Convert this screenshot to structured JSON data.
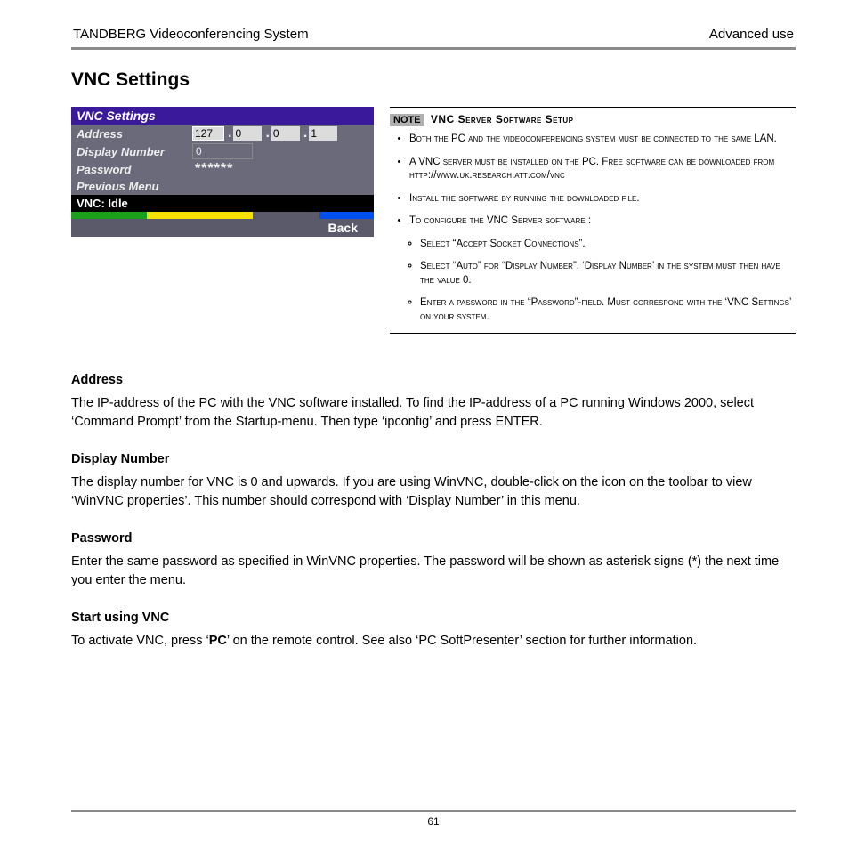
{
  "header": {
    "left": "TANDBERG Videoconferencing System",
    "right": "Advanced use"
  },
  "title": "VNC Settings",
  "panel": {
    "title": "VNC Settings",
    "rows": {
      "address_label": "Address",
      "ip": [
        "127",
        "0",
        "0",
        "1"
      ],
      "display_label": "Display Number",
      "display_value": "0",
      "password_label": "Password",
      "password_value": "******",
      "previous": "Previous Menu",
      "status": "VNC: Idle",
      "back": "Back"
    }
  },
  "note": {
    "badge": "NOTE",
    "title": "VNC Server Software Setup",
    "bullets": [
      "Both the PC and the videoconferencing system must be  connected to the same LAN.",
      "A VNC server must be installed on the PC. Free software can be downloaded from http://www.uk.research.att.com/vnc",
      "Install the software by running the downloaded file.",
      "To configure the VNC Server software :"
    ],
    "sub": [
      "Select “Accept Socket Connections”.",
      "Select “Auto” for “Display Number”. ‘Display Number’ in the system must then have the value 0.",
      "Enter a password in the “Password”-field. Must correspond with the ‘VNC Settings’ on your system."
    ]
  },
  "sections": [
    {
      "h": "Address",
      "p": "The IP-address of the PC with the VNC software installed. To find the IP-address of a PC running Windows 2000, select ‘Command Prompt’ from the Startup-menu. Then type ‘ipconfig’ and press ENTER."
    },
    {
      "h": "Display Number",
      "p": "The display number for VNC is 0 and upwards. If you are using WinVNC, double-click on the icon on the toolbar to view ‘WinVNC properties’. This number should correspond with ‘Display Number’ in this menu."
    },
    {
      "h": "Password",
      "p": "Enter the same password as specified in WinVNC properties. The password will be shown as asterisk signs (*) the next time you enter the menu."
    },
    {
      "h": "Start using VNC",
      "p_html": "To activate VNC, press ‘<b>PC</b>’ on the remote control. See also ‘PC SoftPresenter’ section for further information."
    }
  ],
  "page_number": "61"
}
